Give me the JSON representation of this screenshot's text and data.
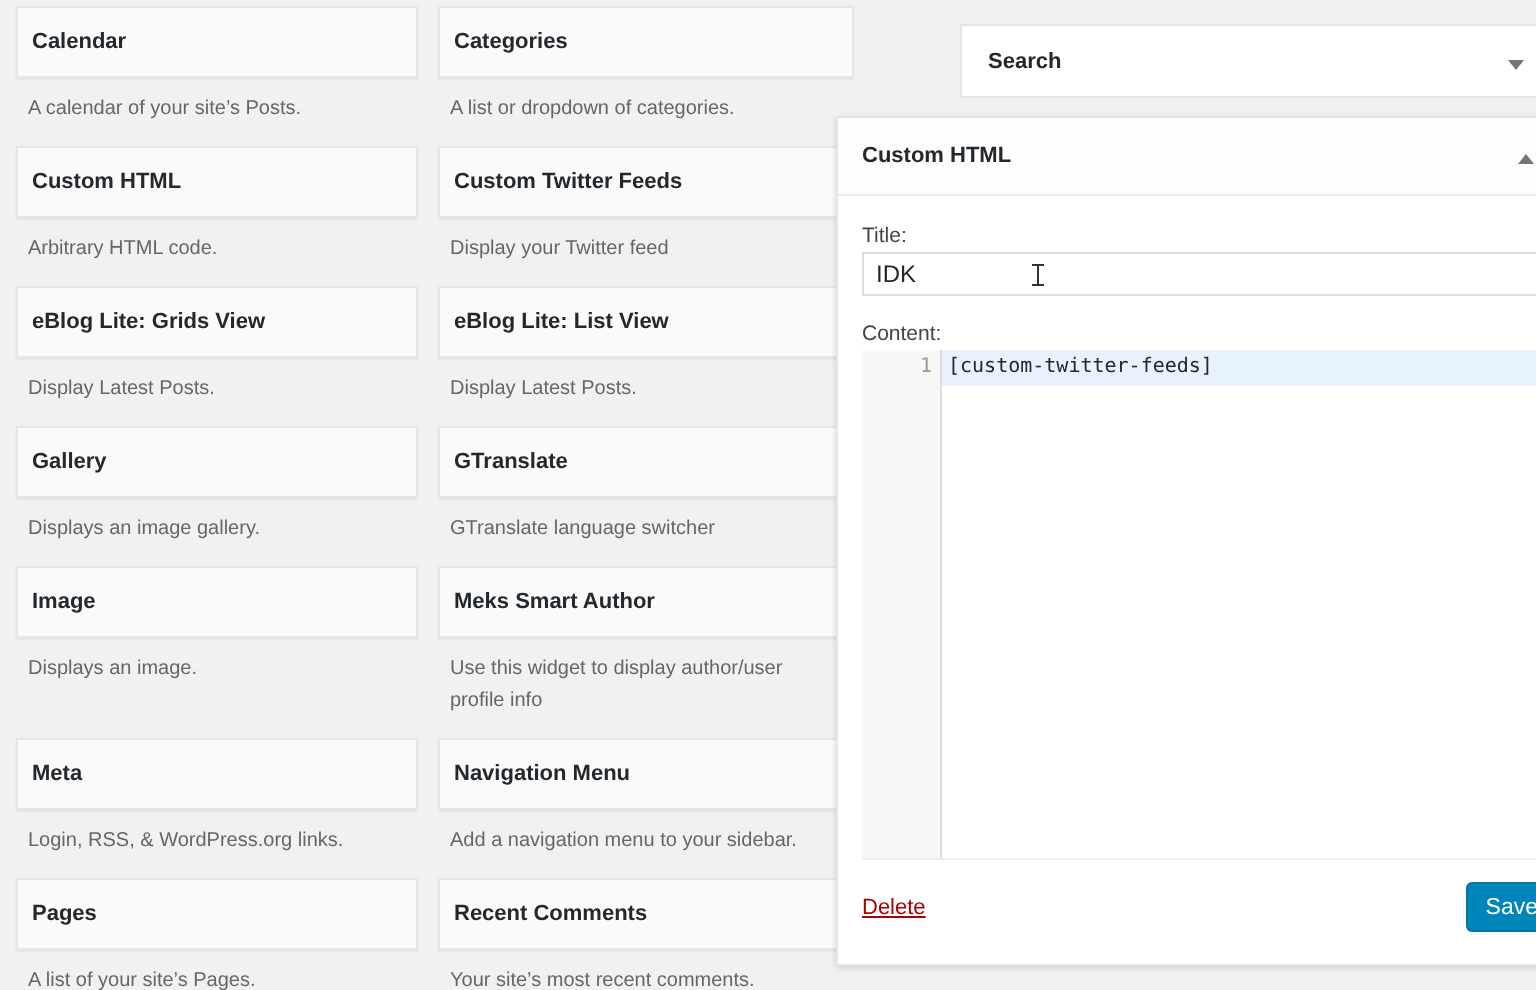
{
  "available_widgets": [
    {
      "title": "Calendar",
      "description": "A calendar of your site’s Posts."
    },
    {
      "title": "Categories",
      "description": "A list or dropdown of categories."
    },
    {
      "title": "Custom HTML",
      "description": "Arbitrary HTML code."
    },
    {
      "title": "Custom Twitter Feeds",
      "description": "Display your Twitter feed"
    },
    {
      "title": "eBlog Lite: Grids View",
      "description": "Display Latest Posts."
    },
    {
      "title": "eBlog Lite: List View",
      "description": "Display Latest Posts."
    },
    {
      "title": "Gallery",
      "description": "Displays an image gallery."
    },
    {
      "title": "GTranslate",
      "description": "GTranslate language switcher"
    },
    {
      "title": "Image",
      "description": "Displays an image."
    },
    {
      "title": "Meks Smart Author",
      "description": "Use this widget to display author/user profile info"
    },
    {
      "title": "Meta",
      "description": "Login, RSS, & WordPress.org links."
    },
    {
      "title": "Navigation Menu",
      "description": "Add a navigation menu to your sidebar."
    },
    {
      "title": "Pages",
      "description": "A list of your site’s Pages."
    },
    {
      "title": "Recent Comments",
      "description": "Your site’s most recent comments."
    }
  ],
  "sidebar_widgets": [
    {
      "title": "Search",
      "expanded": false
    }
  ],
  "open_widget": {
    "title": "Custom HTML",
    "expanded": true,
    "title_label": "Title:",
    "title_value": "IDK",
    "content_label": "Content:",
    "code_lines": [
      {
        "number": "1",
        "text": "[custom-twitter-feeds]",
        "highlighted": true
      }
    ],
    "delete_link": "Delete",
    "save_button": "Save"
  }
}
